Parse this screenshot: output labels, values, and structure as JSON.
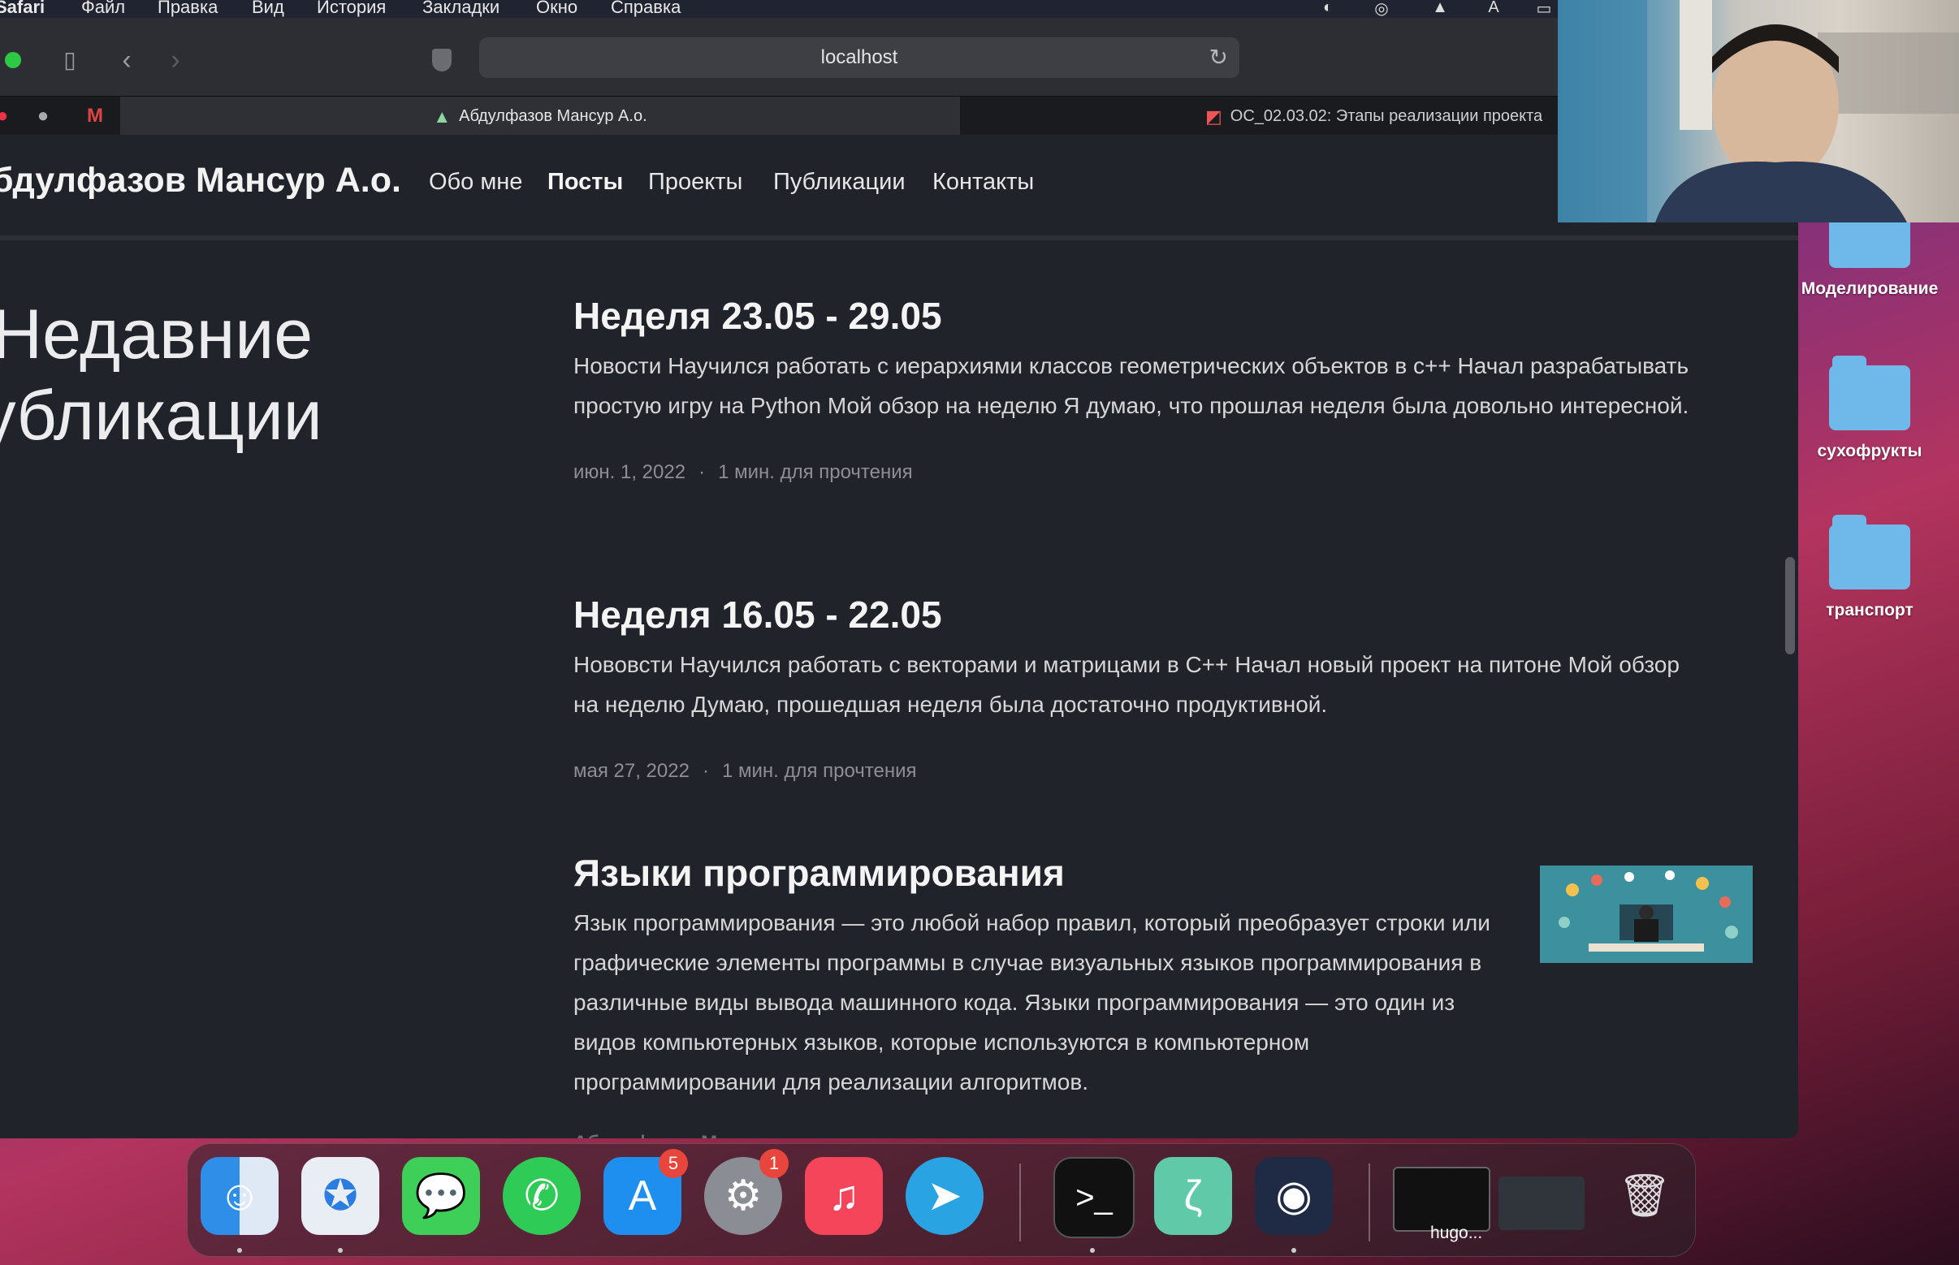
{
  "menubar": {
    "app": "Safari",
    "items": [
      "Файл",
      "Правка",
      "Вид",
      "История",
      "Закладки",
      "Окно",
      "Справка"
    ]
  },
  "browser": {
    "url": "localhost",
    "tabs": [
      {
        "title": "Абдулфазов Мансур А.о.",
        "active": true
      },
      {
        "title": "OC_02.03.02: Этапы реализации проекта",
        "active": false
      }
    ]
  },
  "site": {
    "logo": "бдулфазов Мансур А.о.",
    "nav": [
      "Обо мне",
      "Посты",
      "Проекты",
      "Публикации",
      "Контакты"
    ],
    "active_nav": "Посты",
    "section_title_line1": "Недавние",
    "section_title_line2": "публикации"
  },
  "posts": [
    {
      "title": "Неделя 23.05 - 29.05",
      "summary": "Новости Научился работать с иерархиями классов геометрических объектов в c++ Начал разрабатывать простую игру на Python Мой обзор на неделю Я думаю, что прошлая неделя была довольно интересной.",
      "date": "июн. 1, 2022",
      "reading_time": "1 мин. для прочтения"
    },
    {
      "title": "Неделя 16.05 - 22.05",
      "summary": "Нововсти Научился работать с векторами и матрицами в C++ Начал новый проект на питоне Мой обзор на неделю Думаю, прошедшая неделя была достаточно продуктивной.",
      "date": "мая 27, 2022",
      "reading_time": "1 мин. для прочтения"
    },
    {
      "title": "Языки программирования",
      "summary": "Язык программирования — это любой набор правил, который преобразует строки или графические элементы программы в случае визуальных языков программирования в различные виды вывода машинного кода. Языки программирования — это один из видов компьютерных языков, которые используются в компьютерном программировании для реализации алгоритмов.",
      "author_partial": "Абдулфазов Мансур"
    }
  ],
  "desktop_folders": [
    "Моделирование",
    "сухофрукты",
    "транспорт"
  ],
  "dock": {
    "apps": [
      "Finder",
      "Safari",
      "Messages",
      "WhatsApp",
      "App Store",
      "System Preferences",
      "Music",
      "Telegram",
      "Terminal",
      "Scrivener",
      "OBS"
    ],
    "badges": {
      "app_store": "5",
      "system_preferences": "1"
    },
    "window_label": "hugo..."
  },
  "colors": {
    "page_bg": "#202329",
    "accent_folder": "#6fb9ea",
    "badge": "#e8453c"
  }
}
